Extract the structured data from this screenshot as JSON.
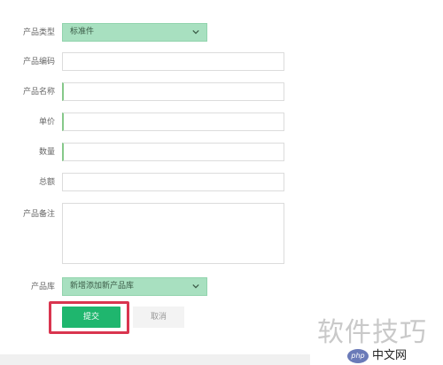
{
  "form": {
    "fields": [
      {
        "label": "产品类型",
        "value": "标准件"
      },
      {
        "label": "产品编码",
        "value": ""
      },
      {
        "label": "产品名称",
        "value": ""
      },
      {
        "label": "单价",
        "value": ""
      },
      {
        "label": "数量",
        "value": ""
      },
      {
        "label": "总额",
        "value": ""
      },
      {
        "label": "产品备注",
        "value": ""
      },
      {
        "label": "产品库",
        "value": "新增添加新产品库"
      }
    ],
    "submit_label": "提交",
    "cancel_label": "取消"
  },
  "watermark": {
    "text": "软件技巧",
    "site": "中文网",
    "logo": "php"
  },
  "colors": {
    "select_bg": "#a8e0c0",
    "submit_bg": "#1fb66e",
    "highlight": "#d9354f"
  }
}
